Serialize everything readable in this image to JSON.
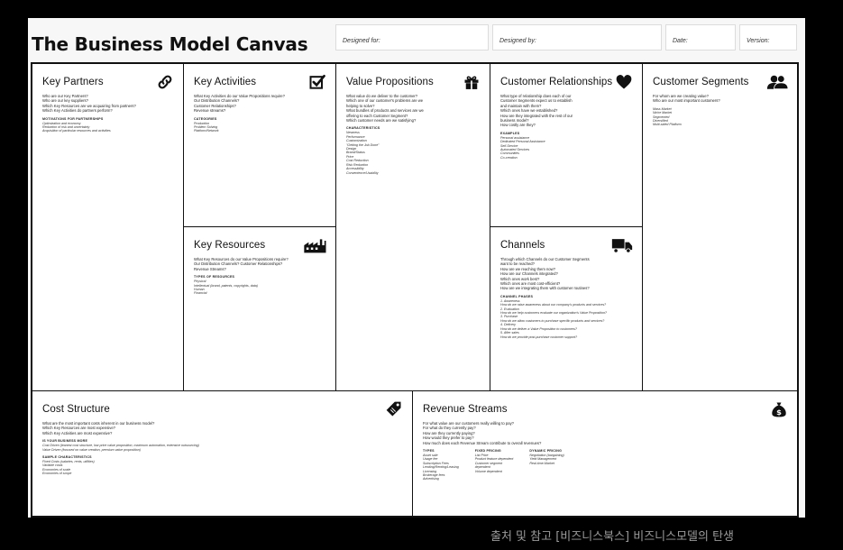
{
  "header": {
    "title": "The Business Model Canvas",
    "designed_for": "Designed for:",
    "designed_by": "Designed by:",
    "date": "Date:",
    "version": "Version:"
  },
  "blocks": {
    "key_partners": {
      "title": "Key Partners",
      "icon": "chain-link-icon",
      "questions": [
        "Who are our Key Partners?",
        "Who are our key suppliers?",
        "Which Key Resources are we acquairing from partners?",
        "Which Key Activities do partners perform?"
      ],
      "sections": [
        {
          "heading": "MOTIVATIONS FOR PARTNERSHIPS",
          "items": [
            "Optimization and economy",
            "Reduction of risk and uncertainty",
            "Acquisition of particular resources and activities"
          ]
        }
      ]
    },
    "key_activities": {
      "title": "Key Activities",
      "icon": "checkbox-icon",
      "questions": [
        "What Key Activities do our Value Propositions require?",
        "Our Distribution Channels?",
        "Customer Relationships?",
        "Revenue streams?"
      ],
      "sections": [
        {
          "heading": "CATEGORIES",
          "items": [
            "Production",
            "Problem Solving",
            "Platform/Network"
          ]
        }
      ]
    },
    "key_resources": {
      "title": "Key Resources",
      "icon": "factory-icon",
      "questions": [
        "What Key Resources do our Value Propositions require?",
        "Our Distribution Channels? Customer Relationships?",
        "Revenue Streams?"
      ],
      "sections": [
        {
          "heading": "TYPES OF RESOURCES",
          "items": [
            "Physical",
            "Intellectual (brand, patents, copyrights, data)",
            "Human",
            "Financial"
          ]
        }
      ]
    },
    "value_propositions": {
      "title": "Value Propositions",
      "icon": "gift-icon",
      "questions": [
        "What value do we deliver to the customer?",
        "Which one of our customer's problems are we",
        "helping to solve?",
        "What bundles of products and services are we",
        "offering to each Customer Segment?",
        "Which customer needs are we satisfying?"
      ],
      "sections": [
        {
          "heading": "CHARACTERISTICS",
          "items": [
            "Newness",
            "Performance",
            "Customization",
            "\"Getting the Job Done\"",
            "Design",
            "Brand/Status",
            "Price",
            "Cost Reduction",
            "Risk Reduction",
            "Accessibility",
            "Convenience/Usability"
          ]
        }
      ]
    },
    "customer_relationships": {
      "title": "Customer Relationships",
      "icon": "heart-icon",
      "questions": [
        "What type of relationship does each of our",
        "Customer Segments expect us to establish",
        "and maintain with them?",
        "Which ones have we established?",
        "How are they integrated with the rest of our",
        "business model?",
        "How costly are they?"
      ],
      "sections": [
        {
          "heading": "EXAMPLES",
          "items": [
            "Personal assistance",
            "Dedicated Personal Assistance",
            "Self-Service",
            "Automated Services",
            "Communities",
            "Co-creation"
          ]
        }
      ]
    },
    "channels": {
      "title": "Channels",
      "icon": "truck-icon",
      "questions": [
        "Through which Channels do our Customer Segments",
        "want to be reached?",
        "How are we reaching them now?",
        "How are our Channels integrated?",
        "Which ones work best?",
        "Which ones are most cost-efficient?",
        "How are we integrating them with customer routines?"
      ],
      "sections": [
        {
          "heading": "CHANNEL PHASES",
          "items": [
            "1. Awareness",
            "How do we raise awareness about our company's products and services?",
            "2. Evaluation",
            "How do we help customers evaluate our organization's Value Proposition?",
            "3. Purchase",
            "How do we allow customers to purchase specific products and services?",
            "4. Delivery",
            "How do we deliver a Value Proposition to customers?",
            "5. After sales",
            "How do we provide post-purchase customer support?"
          ]
        }
      ]
    },
    "customer_segments": {
      "title": "Customer Segments",
      "icon": "people-icon",
      "questions": [
        "For whom are we creating value?",
        "Who are our most important customers?"
      ],
      "sections": [
        {
          "heading": "",
          "items": [
            "Mass Market",
            "Niche Market",
            "Segmented",
            "Diversified",
            "Multi-sided Platform"
          ]
        }
      ]
    },
    "cost_structure": {
      "title": "Cost Structure",
      "icon": "price-tag-icon",
      "questions": [
        "What are the most important costs inherent in our business model?",
        "Which Key Resources are most expensive?",
        "Which Key Activities are most expensive?"
      ],
      "sections": [
        {
          "heading": "IS YOUR BUSINESS MORE",
          "items": [
            "Cost Driven (leanest cost structure, low price value proposition, maximum automation, extensive outsourcing)",
            "Value Driven (focused on value creation, premium value proposition)"
          ]
        },
        {
          "heading": "SAMPLE CHARACTERISTICS",
          "items": [
            "Fixed Costs (salaries, rents, utilities)",
            "Variable costs",
            "Economies of scale",
            "Economies of scope"
          ]
        }
      ]
    },
    "revenue_streams": {
      "title": "Revenue Streams",
      "icon": "money-bag-icon",
      "questions": [
        "For what value are our customers really willing to pay?",
        "For what do they currently pay?",
        "How are they currently paying?",
        "How would they prefer to pay?",
        "How much does each Revenue Stream contribute to overall revenues?"
      ],
      "columns": [
        {
          "heading": "TYPES",
          "items": [
            "Asset sale",
            "Usage fee",
            "Subscription Fees",
            "Lending/Renting/Leasing",
            "Licensing",
            "Brokerage fees",
            "Advertising"
          ]
        },
        {
          "heading": "FIXED PRICING",
          "items": [
            "List Price",
            "Product feature dependent",
            "Customer segment",
            "dependent",
            "Volume dependent"
          ]
        },
        {
          "heading": "DYNAMIC PRICING",
          "items": [
            "Negotiation (bargaining)",
            "Yield Management",
            "Real-time-Market"
          ]
        }
      ]
    }
  },
  "credit": "출처 및 참고 [비즈니스북스] 비즈니스모델의 탄생"
}
